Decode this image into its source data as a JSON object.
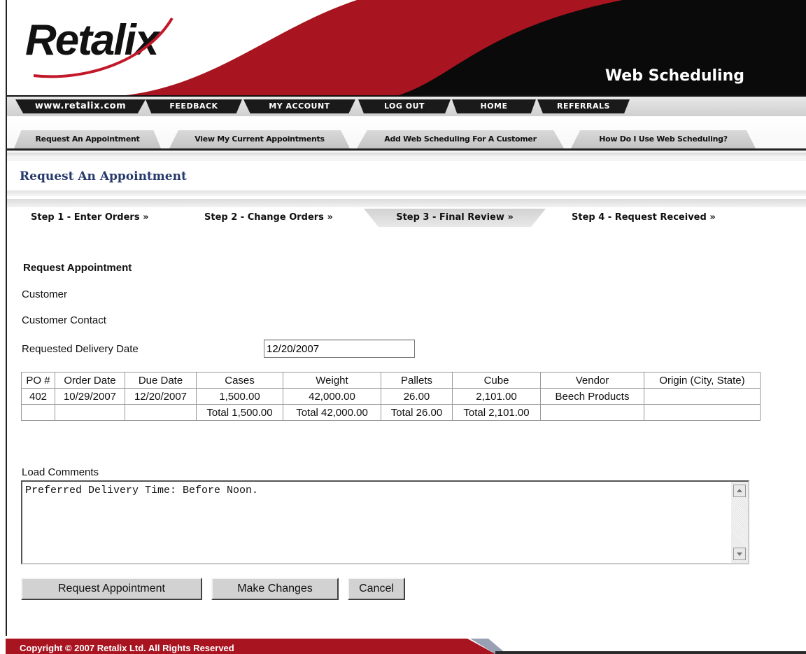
{
  "header": {
    "logo_text": "Retalix",
    "app_title": "Web Scheduling",
    "colors": {
      "red": "#a8141f",
      "black": "#0a0a0a"
    }
  },
  "top_nav": [
    {
      "label": "www.retalix.com"
    },
    {
      "label": "FEEDBACK"
    },
    {
      "label": "MY ACCOUNT"
    },
    {
      "label": "LOG OUT"
    },
    {
      "label": "HOME"
    },
    {
      "label": "REFERRALS"
    }
  ],
  "tabs": [
    {
      "label": "Request An Appointment"
    },
    {
      "label": "View My Current Appointments"
    },
    {
      "label": "Add Web Scheduling For A Customer"
    },
    {
      "label": "How Do I Use Web Scheduling?"
    }
  ],
  "page_title": "Request An Appointment",
  "steps": [
    {
      "label": "Step 1 - Enter Orders »"
    },
    {
      "label": "Step 2 - Change Orders »"
    },
    {
      "label": "Step 3 -  Final Review »",
      "active": true
    },
    {
      "label": "Step 4 - Request Received »"
    }
  ],
  "form": {
    "heading": "Request Appointment",
    "customer_label": "Customer",
    "contact_label": "Customer Contact",
    "delivery_date_label": "Requested Delivery Date",
    "delivery_date_value": "12/20/2007"
  },
  "table": {
    "headers": [
      "PO #",
      "Order Date",
      "Due Date",
      "Cases",
      "Weight",
      "Pallets",
      "Cube",
      "Vendor",
      "Origin (City, State)"
    ],
    "rows": [
      [
        "402",
        "10/29/2007",
        "12/20/2007",
        "1,500.00",
        "42,000.00",
        "26.00",
        "2,101.00",
        "Beech Products",
        ""
      ],
      [
        "",
        "",
        "",
        "Total 1,500.00",
        "Total 42,000.00",
        "Total 26.00",
        "Total 2,101.00",
        "",
        ""
      ]
    ]
  },
  "comments": {
    "label": "Load Comments",
    "value": "Preferred Delivery Time: Before Noon."
  },
  "buttons": {
    "request": "Request Appointment",
    "changes": "Make Changes",
    "cancel": "Cancel"
  },
  "footer": {
    "copyright": "Copyright © 2007 Retalix Ltd.  All Rights Reserved"
  }
}
